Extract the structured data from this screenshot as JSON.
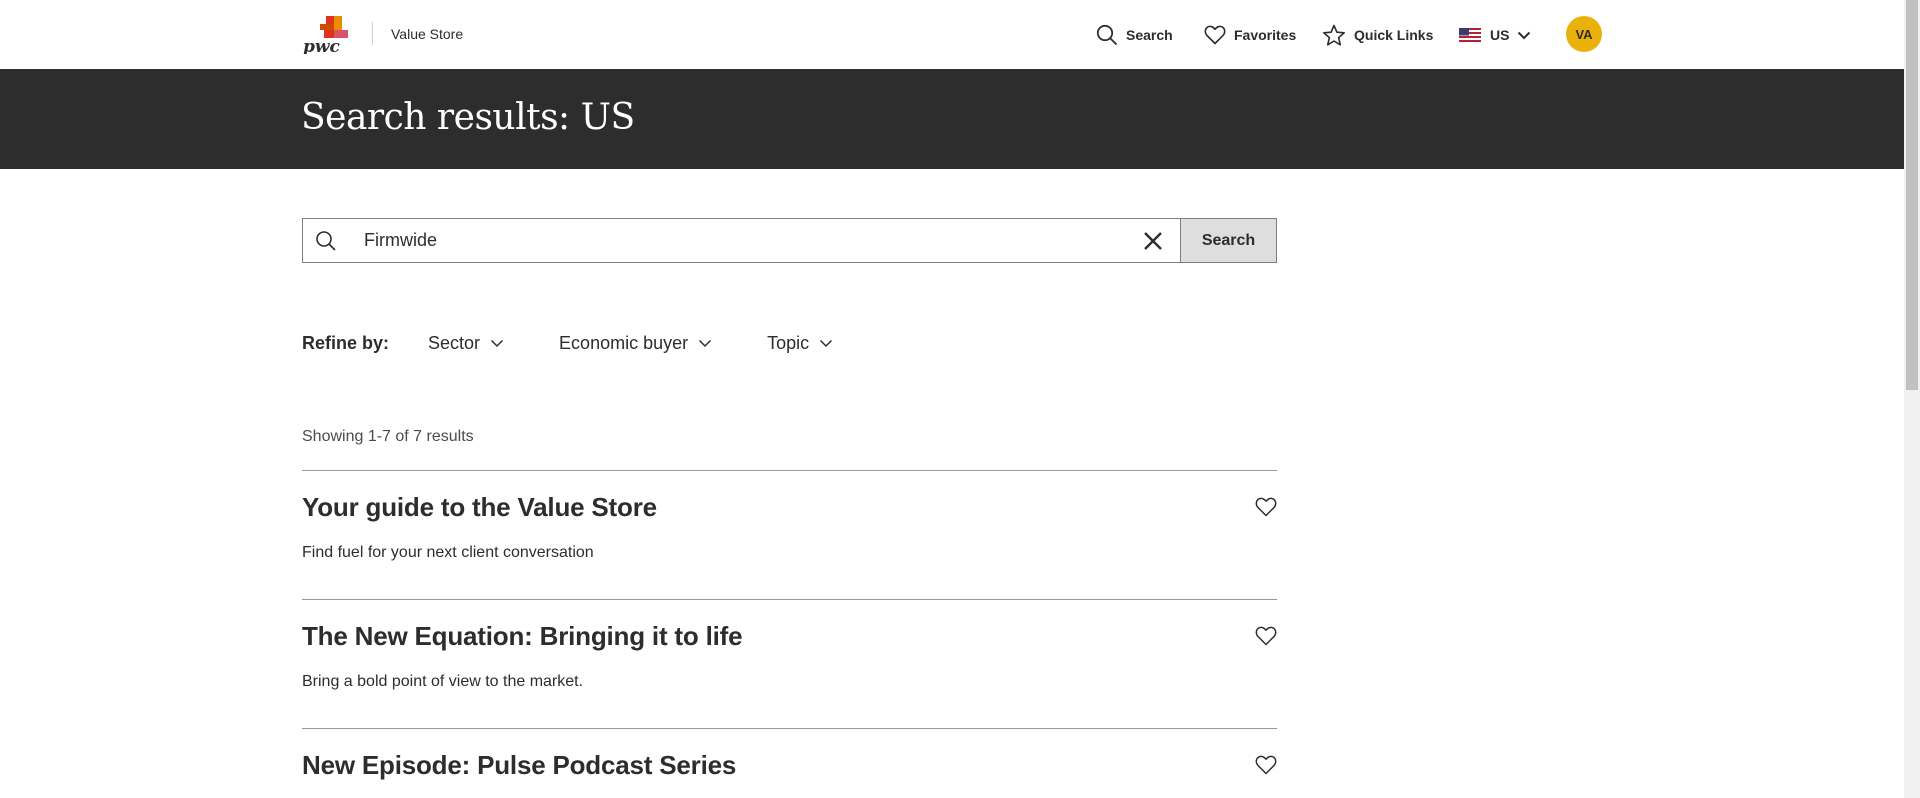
{
  "header": {
    "logo_text": "pwc",
    "app_name": "Value Store",
    "nav": {
      "search": "Search",
      "favorites": "Favorites",
      "quick_links": "Quick Links",
      "region": "US"
    },
    "avatar_initials": "VA"
  },
  "hero": {
    "title": "Search results: US"
  },
  "search": {
    "value": "Firmwide",
    "button_label": "Search"
  },
  "refine": {
    "label": "Refine by:",
    "filters": [
      "Sector",
      "Economic buyer",
      "Topic"
    ]
  },
  "results_count": "Showing 1-7 of 7 results",
  "results": [
    {
      "title": "Your guide to the Value Store",
      "description": "Find fuel for your next client conversation"
    },
    {
      "title": "The New Equation: Bringing it to life",
      "description": "Bring a bold point of view to the market."
    },
    {
      "title": "New Episode: Pulse Podcast Series",
      "description": ""
    }
  ],
  "colors": {
    "hero_bg": "#2d2d2d",
    "avatar_bg": "#ebb10b",
    "search_button_bg": "#dedede",
    "text": "#2d2d2d"
  },
  "icons": [
    "search-icon",
    "heart-icon",
    "star-icon",
    "us-flag-icon",
    "chevron-down-icon",
    "close-icon"
  ]
}
